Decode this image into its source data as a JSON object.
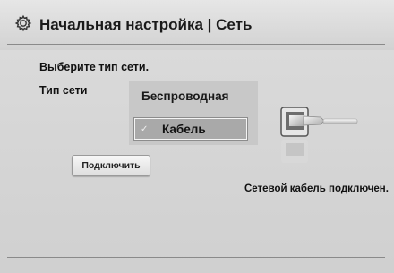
{
  "header": {
    "title": "Начальная настройка | Сеть",
    "icon": "gear-icon"
  },
  "main": {
    "prompt": "Выберите тип сети.",
    "network_type_label": "Тип сети",
    "options": [
      {
        "label": "Беспроводная",
        "selected": false
      },
      {
        "label": "Кабель",
        "selected": true
      }
    ],
    "connect_label": "Подключить",
    "status": "Сетевой кабель подключен.",
    "illustration_icon": "ethernet-cable-icon"
  },
  "colors": {
    "background": "#d4d4d4",
    "selected_option": "#a9a9a9",
    "panel": "#c8c8c8"
  }
}
